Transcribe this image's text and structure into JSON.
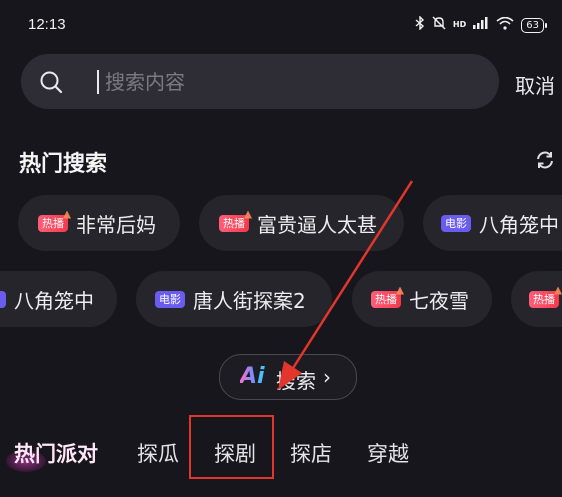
{
  "status_bar": {
    "time": "12:13",
    "signal_label": "HD",
    "battery": "63"
  },
  "search": {
    "placeholder": "搜索内容",
    "cancel_label": "取消"
  },
  "hot_search": {
    "title": "热门搜索",
    "row1": [
      {
        "badge": "热播",
        "badge_type": "hot",
        "text": "非常后妈"
      },
      {
        "badge": "热播",
        "badge_type": "hot",
        "text": "富贵逼人太甚"
      },
      {
        "badge": "电影",
        "badge_type": "movie",
        "text": "八角笼中"
      }
    ],
    "row2": [
      {
        "badge": "",
        "badge_type": "movie",
        "text": "八角笼中"
      },
      {
        "badge": "电影",
        "badge_type": "movie",
        "text": "唐人街探案2"
      },
      {
        "badge": "热播",
        "badge_type": "hot",
        "text": "七夜雪"
      },
      {
        "badge": "热播",
        "badge_type": "hot",
        "text": ""
      }
    ]
  },
  "ai_search": {
    "logo": "Ai",
    "label": "搜索",
    "chevron": "›"
  },
  "tabs": {
    "items": [
      "热门派对",
      "探瓜",
      "探剧",
      "探店",
      "穿越"
    ],
    "highlighted": "探剧"
  },
  "colors": {
    "background": "#17161c",
    "hot_badge": "#f23a4b",
    "movie_badge": "#6b5cf0",
    "annotation": "#e2362c"
  }
}
